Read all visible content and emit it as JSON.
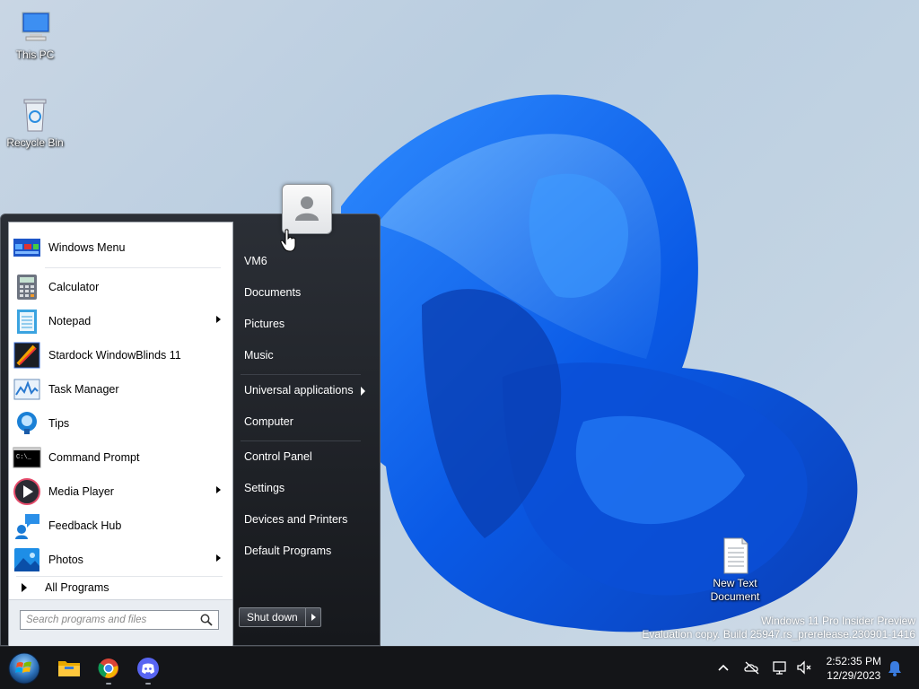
{
  "desktop": {
    "icons": [
      {
        "label": "This PC"
      },
      {
        "label": "Recycle Bin"
      },
      {
        "label": "New Text Document"
      }
    ]
  },
  "start_menu": {
    "pinned": [
      {
        "label": "Windows Menu",
        "icon": "windows-menu-icon"
      }
    ],
    "programs": [
      {
        "label": "Calculator",
        "icon": "calculator-icon",
        "submenu": false
      },
      {
        "label": "Notepad",
        "icon": "notepad-icon",
        "submenu": true
      },
      {
        "label": "Stardock WindowBlinds 11",
        "icon": "windowblinds-icon",
        "submenu": false
      },
      {
        "label": "Task Manager",
        "icon": "task-manager-icon",
        "submenu": false
      },
      {
        "label": "Tips",
        "icon": "tips-icon",
        "submenu": false
      },
      {
        "label": "Command Prompt",
        "icon": "command-prompt-icon",
        "submenu": false
      },
      {
        "label": "Media Player",
        "icon": "media-player-icon",
        "submenu": true
      },
      {
        "label": "Feedback Hub",
        "icon": "feedback-hub-icon",
        "submenu": false
      },
      {
        "label": "Photos",
        "icon": "photos-icon",
        "submenu": true
      }
    ],
    "all_programs_label": "All Programs",
    "search_placeholder": "Search programs and files",
    "right": {
      "user_name": "VM6",
      "items": [
        "Documents",
        "Pictures",
        "Music",
        "Universal applications",
        "Computer",
        "Control Panel",
        "Settings",
        "Devices and Printers",
        "Default Programs"
      ],
      "shutdown_label": "Shut down"
    }
  },
  "watermark": {
    "line1": "Windows 11 Pro Insider Preview",
    "line2": "Evaluation copy. Build 25947.rs_prerelease.230901-1416"
  },
  "taskbar": {
    "apps": [
      "start-orb-icon",
      "file-explorer-icon",
      "chrome-icon",
      "discord-icon"
    ],
    "clock": {
      "time": "2:52:35 PM",
      "date": "12/29/2023"
    }
  },
  "colors": {
    "accent": "#1a6ae0",
    "taskbar": "#141518"
  }
}
